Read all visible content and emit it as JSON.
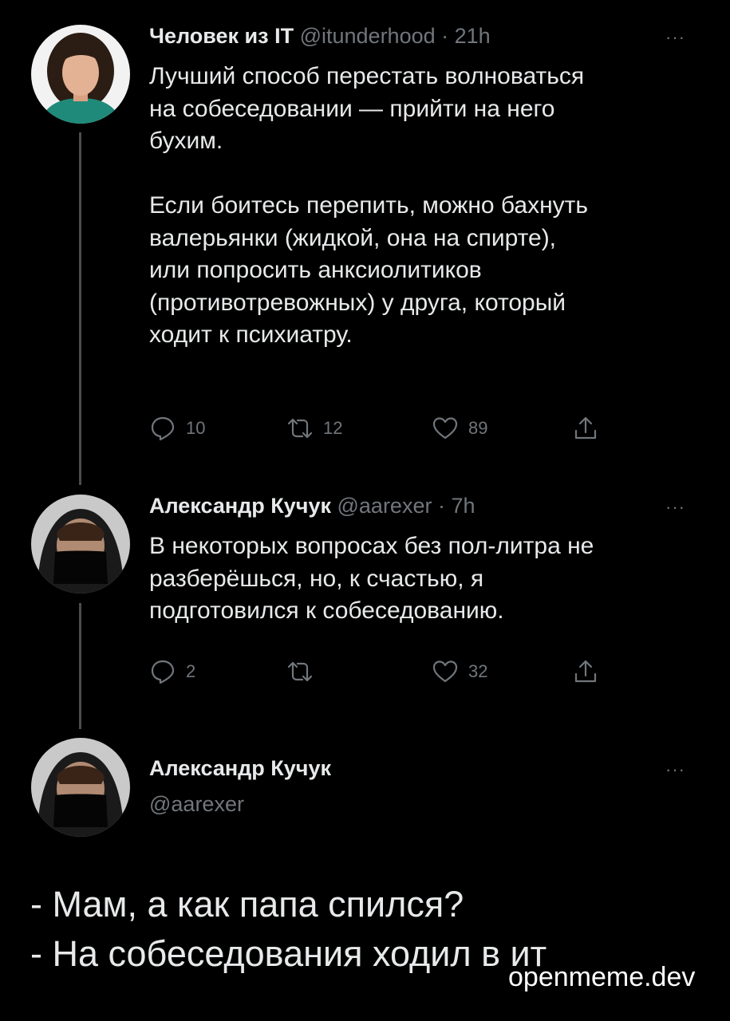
{
  "tweets": [
    {
      "name": "Человек из IT",
      "handle": "@itunderhood",
      "time": "· 21h",
      "more": "···",
      "text_lines": [
        "Лучший способ перестать волноваться",
        "на собеседовании — прийти на него",
        "бухим.",
        "",
        "Если боитесь перепить, можно бахнуть",
        "валерьянки (жидкой, она на спирте),",
        "или попросить анксиолитиков",
        "(противотревожных) у друга, который",
        "ходит к психиатру."
      ],
      "replies": "10",
      "retweets": "12",
      "likes": "89"
    },
    {
      "name": "Александр Кучук",
      "handle": "@aarexer",
      "time": "· 7h",
      "more": "···",
      "text_lines": [
        "В некоторых вопросах без пол-литра не",
        "разберёшься, но, к счастью, я",
        "подготовился к собеседованию."
      ],
      "replies": "2",
      "retweets": "",
      "likes": "32"
    },
    {
      "name": "Александр Кучук",
      "handle": "@aarexer",
      "more": "···"
    }
  ],
  "joke": {
    "line1": "- Мам, а как папа спился?",
    "line2": "- На собеседования ходил в ит"
  },
  "watermark": "openmeme.dev",
  "icons": {
    "reply": "reply-icon",
    "retweet": "retweet-icon",
    "like": "heart-icon",
    "share": "share-icon",
    "more": "more-icon"
  },
  "colors": {
    "background": "#000000",
    "text": "#e7e9ea",
    "muted": "#71767b",
    "thread_line": "#4a4d50"
  }
}
